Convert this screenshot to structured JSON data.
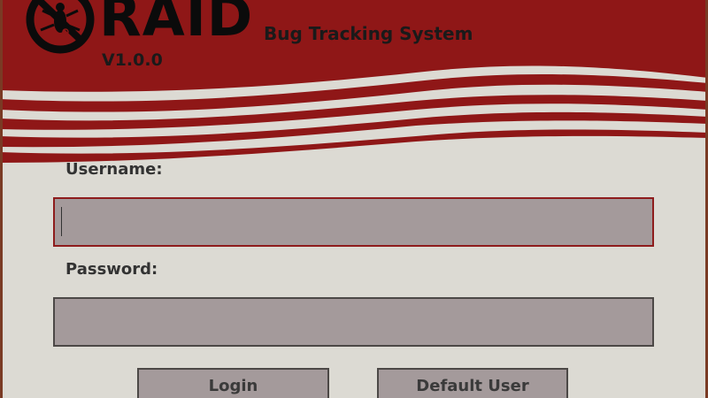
{
  "app": {
    "logo_text": "RAID",
    "subtitle": "Bug Tracking System",
    "version": "V1.0.0"
  },
  "form": {
    "username_label": "Username:",
    "username_value": "",
    "password_label": "Password:",
    "password_value": ""
  },
  "buttons": {
    "login_label": "Login",
    "default_user_label": "Default User"
  },
  "colors": {
    "brand_red": "#8f1717",
    "background": "#dcdad3",
    "field_fill": "#a49a9b",
    "focus_border": "#8e1c1c"
  },
  "icons": {
    "logo": "bug-prohibited-icon"
  }
}
